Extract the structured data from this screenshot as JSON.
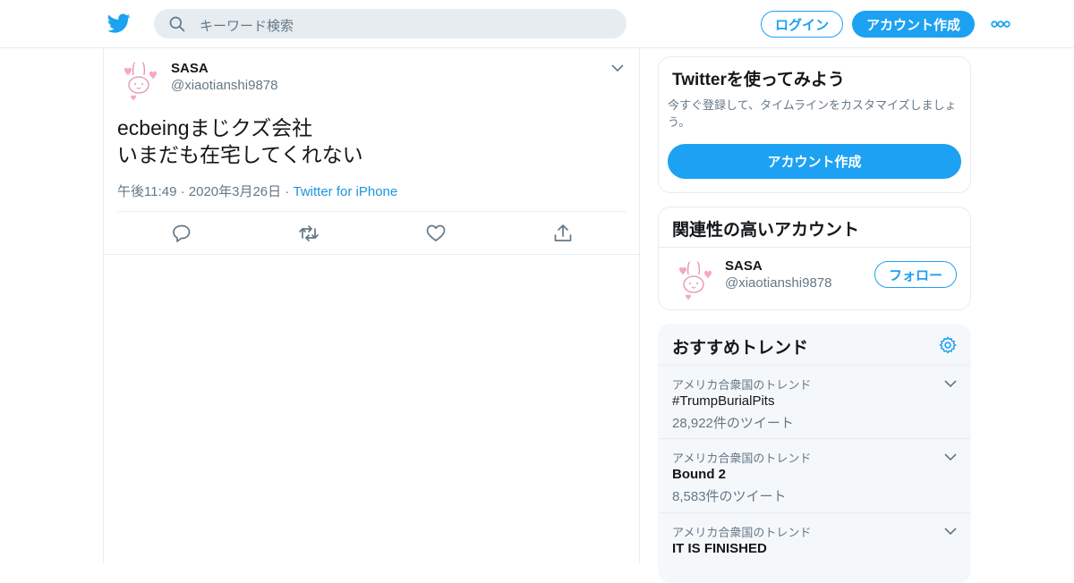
{
  "header": {
    "logo_icon": "twitter-bird-icon",
    "search": {
      "placeholder": "キーワード検索",
      "icon": "search-icon"
    },
    "login_label": "ログイン",
    "signup_label": "アカウント作成",
    "more_icon": "more-dots-icon"
  },
  "tweet": {
    "name": "SASA",
    "handle": "@xiaotianshi9878",
    "text_lines": [
      "ecbeingまじクズ会社",
      "いまだも在宅してくれない"
    ],
    "timestamp": "午後11:49 · 2020年3月26日",
    "separator": " · ",
    "source": "Twitter for iPhone",
    "actions": [
      "reply-icon",
      "retweet-icon",
      "like-icon",
      "share-icon"
    ]
  },
  "sidebar": {
    "signup_card": {
      "title": "Twitterを使ってみよう",
      "description": "今すぐ登録して、タイムラインをカスタマイズしましょう。",
      "button_label": "アカウント作成"
    },
    "related_card": {
      "title": "関連性の高いアカウント",
      "name": "SASA",
      "handle": "@xiaotianshi9878",
      "follow_label": "フォロー"
    },
    "trends_card": {
      "title": "おすすめトレンド",
      "items": [
        {
          "context": "アメリカ合衆国のトレンド",
          "name": "#TrumpBurialPits",
          "count": "28,922件のツイート"
        },
        {
          "context": "アメリカ合衆国のトレンド",
          "name": "Bound 2",
          "count": "8,583件のツイート"
        },
        {
          "context": "アメリカ合衆国のトレンド",
          "name": "IT IS FINISHED",
          "count": ""
        }
      ]
    }
  },
  "colors": {
    "accent": "#1da1f2",
    "text_secondary": "#657786",
    "border": "#e6ecf0",
    "link": "#1b95e0"
  }
}
